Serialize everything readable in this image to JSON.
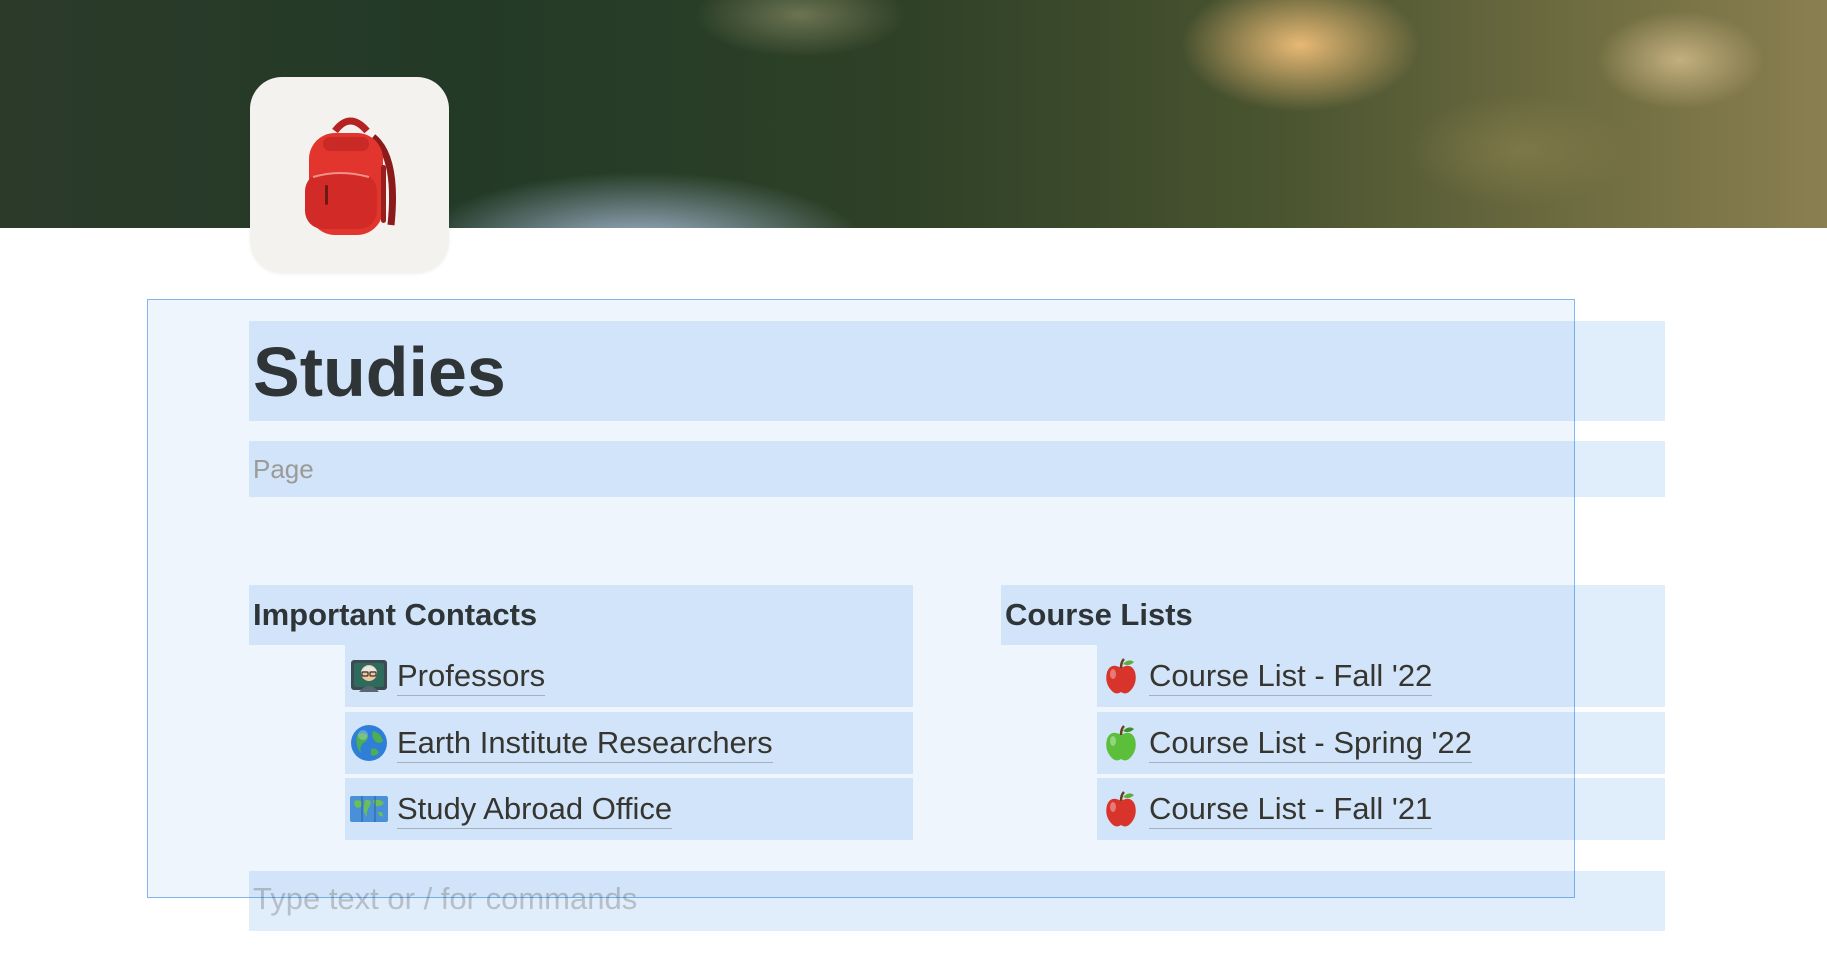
{
  "page": {
    "title": "Studies",
    "property_label": "Page",
    "icon": "backpack-icon",
    "placeholder": "Type text or / for commands"
  },
  "columns": [
    {
      "heading": "Important Contacts",
      "items": [
        {
          "icon": "teacher-icon",
          "label": "Professors"
        },
        {
          "icon": "globe-icon",
          "label": "Earth Institute Researchers"
        },
        {
          "icon": "world-map-icon",
          "label": "Study Abroad Office"
        }
      ]
    },
    {
      "heading": "Course Lists",
      "items": [
        {
          "icon": "red-apple-icon",
          "label": "Course List - Fall '22"
        },
        {
          "icon": "green-apple-icon",
          "label": "Course List - Spring '22"
        },
        {
          "icon": "red-apple-icon",
          "label": "Course List - Fall '21"
        }
      ]
    }
  ],
  "colors": {
    "selection": "#2383e2",
    "text": "#37352f",
    "title": "#2f3437",
    "muted": "#9b9a97"
  }
}
